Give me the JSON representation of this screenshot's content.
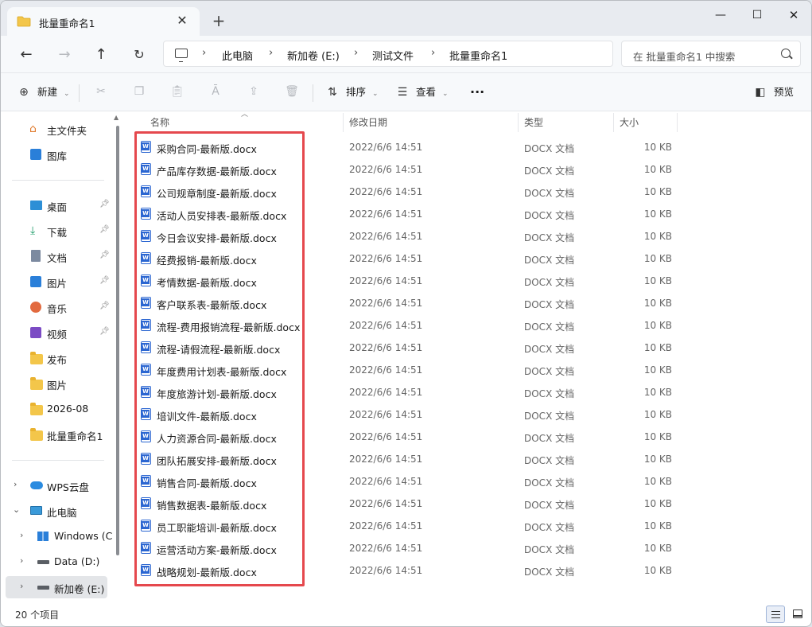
{
  "window": {
    "tab_title": "批量重命名1",
    "tab_close": "✕",
    "new_tab": "+",
    "minimize": "—",
    "maximize": "☐",
    "close": "✕"
  },
  "address": {
    "crumbs": [
      "此电脑",
      "新加卷 (E:)",
      "测试文件",
      "批量重命名1"
    ],
    "separator": "›",
    "search_placeholder": "在 批量重命名1 中搜索"
  },
  "toolbar": {
    "new_label": "新建",
    "sort_label": "排序",
    "view_label": "查看",
    "more_label": "···",
    "preview_label": "预览"
  },
  "sidebar": {
    "quick": [
      {
        "label": "主文件夹",
        "icon": "home-icon"
      },
      {
        "label": "图库",
        "icon": "gallery-icon"
      }
    ],
    "pinned": [
      {
        "label": "桌面",
        "icon": "desktop-icon",
        "pinned": true
      },
      {
        "label": "下载",
        "icon": "download-icon",
        "pinned": true
      },
      {
        "label": "文档",
        "icon": "document-icon",
        "pinned": true
      },
      {
        "label": "图片",
        "icon": "pictures-icon",
        "pinned": true
      },
      {
        "label": "音乐",
        "icon": "music-icon",
        "pinned": true
      },
      {
        "label": "视频",
        "icon": "video-icon",
        "pinned": true
      },
      {
        "label": "发布",
        "icon": "folder-icon",
        "pinned": false
      },
      {
        "label": "图片",
        "icon": "folder-icon",
        "pinned": false
      },
      {
        "label": "2026-08",
        "icon": "folder-icon",
        "pinned": false
      },
      {
        "label": "批量重命名1",
        "icon": "folder-icon",
        "pinned": false
      }
    ],
    "tree": [
      {
        "label": "WPS云盘",
        "icon": "cloud-icon",
        "expanded": false
      },
      {
        "label": "此电脑",
        "icon": "computer-icon",
        "expanded": true
      },
      {
        "label": "Windows (C",
        "icon": "windows-drive-icon",
        "expanded": false
      },
      {
        "label": "Data (D:)",
        "icon": "drive-icon",
        "expanded": false
      },
      {
        "label": "新加卷 (E:)",
        "icon": "drive-icon",
        "expanded": false,
        "selected": true
      }
    ]
  },
  "columns": {
    "name": "名称",
    "date": "修改日期",
    "type": "类型",
    "size": "大小"
  },
  "files": [
    {
      "name": "采购合同-最新版.docx",
      "date": "2022/6/6 14:51",
      "type": "DOCX 文档",
      "size": "10 KB"
    },
    {
      "name": "产品库存数据-最新版.docx",
      "date": "2022/6/6 14:51",
      "type": "DOCX 文档",
      "size": "10 KB"
    },
    {
      "name": "公司规章制度-最新版.docx",
      "date": "2022/6/6 14:51",
      "type": "DOCX 文档",
      "size": "10 KB"
    },
    {
      "name": "活动人员安排表-最新版.docx",
      "date": "2022/6/6 14:51",
      "type": "DOCX 文档",
      "size": "10 KB"
    },
    {
      "name": "今日会议安排-最新版.docx",
      "date": "2022/6/6 14:51",
      "type": "DOCX 文档",
      "size": "10 KB"
    },
    {
      "name": "经费报销-最新版.docx",
      "date": "2022/6/6 14:51",
      "type": "DOCX 文档",
      "size": "10 KB"
    },
    {
      "name": "考情数据-最新版.docx",
      "date": "2022/6/6 14:51",
      "type": "DOCX 文档",
      "size": "10 KB"
    },
    {
      "name": "客户联系表-最新版.docx",
      "date": "2022/6/6 14:51",
      "type": "DOCX 文档",
      "size": "10 KB"
    },
    {
      "name": "流程-费用报销流程-最新版.docx",
      "date": "2022/6/6 14:51",
      "type": "DOCX 文档",
      "size": "10 KB"
    },
    {
      "name": "流程-请假流程-最新版.docx",
      "date": "2022/6/6 14:51",
      "type": "DOCX 文档",
      "size": "10 KB"
    },
    {
      "name": "年度费用计划表-最新版.docx",
      "date": "2022/6/6 14:51",
      "type": "DOCX 文档",
      "size": "10 KB"
    },
    {
      "name": "年度旅游计划-最新版.docx",
      "date": "2022/6/6 14:51",
      "type": "DOCX 文档",
      "size": "10 KB"
    },
    {
      "name": "培训文件-最新版.docx",
      "date": "2022/6/6 14:51",
      "type": "DOCX 文档",
      "size": "10 KB"
    },
    {
      "name": "人力资源合同-最新版.docx",
      "date": "2022/6/6 14:51",
      "type": "DOCX 文档",
      "size": "10 KB"
    },
    {
      "name": "团队拓展安排-最新版.docx",
      "date": "2022/6/6 14:51",
      "type": "DOCX 文档",
      "size": "10 KB"
    },
    {
      "name": "销售合同-最新版.docx",
      "date": "2022/6/6 14:51",
      "type": "DOCX 文档",
      "size": "10 KB"
    },
    {
      "name": "销售数据表-最新版.docx",
      "date": "2022/6/6 14:51",
      "type": "DOCX 文档",
      "size": "10 KB"
    },
    {
      "name": "员工职能培训-最新版.docx",
      "date": "2022/6/6 14:51",
      "type": "DOCX 文档",
      "size": "10 KB"
    },
    {
      "name": "运营活动方案-最新版.docx",
      "date": "2022/6/6 14:51",
      "type": "DOCX 文档",
      "size": "10 KB"
    },
    {
      "name": "战略规划-最新版.docx",
      "date": "2022/6/6 14:51",
      "type": "DOCX 文档",
      "size": "10 KB"
    }
  ],
  "status": {
    "item_count": "20 个项目"
  },
  "colors": {
    "highlight": "#e5484d",
    "word_blue": "#2b66d1",
    "folder_yellow": "#f3c64a"
  }
}
